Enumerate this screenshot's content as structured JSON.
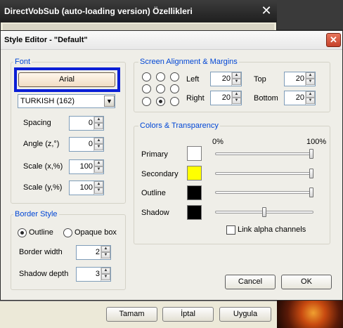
{
  "parent_window": {
    "title": "DirectVobSub (auto-loading version) Özellikleri",
    "close_glyph": "✕",
    "buttons": {
      "ok": "Tamam",
      "cancel": "İptal",
      "apply": "Uygula"
    }
  },
  "dialog": {
    "title": "Style Editor - \"Default\"",
    "close_glyph": "✕",
    "font": {
      "group_label": "Font",
      "font_button": "Arial",
      "charset": "TURKISH (162)",
      "spacing_label": "Spacing",
      "spacing": "0",
      "angle_label": "Angle (z,°)",
      "angle": "0",
      "scale_x_label": "Scale (x,%)",
      "scale_x": "100",
      "scale_y_label": "Scale (y,%)",
      "scale_y": "100"
    },
    "border": {
      "group_label": "Border Style",
      "outline_label": "Outline",
      "opaque_label": "Opaque box",
      "selected": "Outline",
      "width_label": "Border width",
      "width": "2",
      "shadow_label": "Shadow depth",
      "shadow": "3"
    },
    "alignment": {
      "group_label": "Screen Alignment & Margins",
      "selected_position": "bottom-center",
      "left_label": "Left",
      "left": "20",
      "top_label": "Top",
      "top": "20",
      "right_label": "Right",
      "right": "20",
      "bottom_label": "Bottom",
      "bottom": "20"
    },
    "colors": {
      "group_label": "Colors & Transparency",
      "scale_min": "0%",
      "scale_max": "100%",
      "rows": [
        {
          "label": "Primary",
          "color": "#ffffff",
          "alpha_percent": 100
        },
        {
          "label": "Secondary",
          "color": "#ffff00",
          "alpha_percent": 100
        },
        {
          "label": "Outline",
          "color": "#000000",
          "alpha_percent": 100
        },
        {
          "label": "Shadow",
          "color": "#000000",
          "alpha_percent": 50
        }
      ],
      "link_label": "Link alpha channels",
      "link_checked": false
    },
    "buttons": {
      "cancel": "Cancel",
      "ok": "OK"
    }
  },
  "highlight_color": "#0a1ed6"
}
